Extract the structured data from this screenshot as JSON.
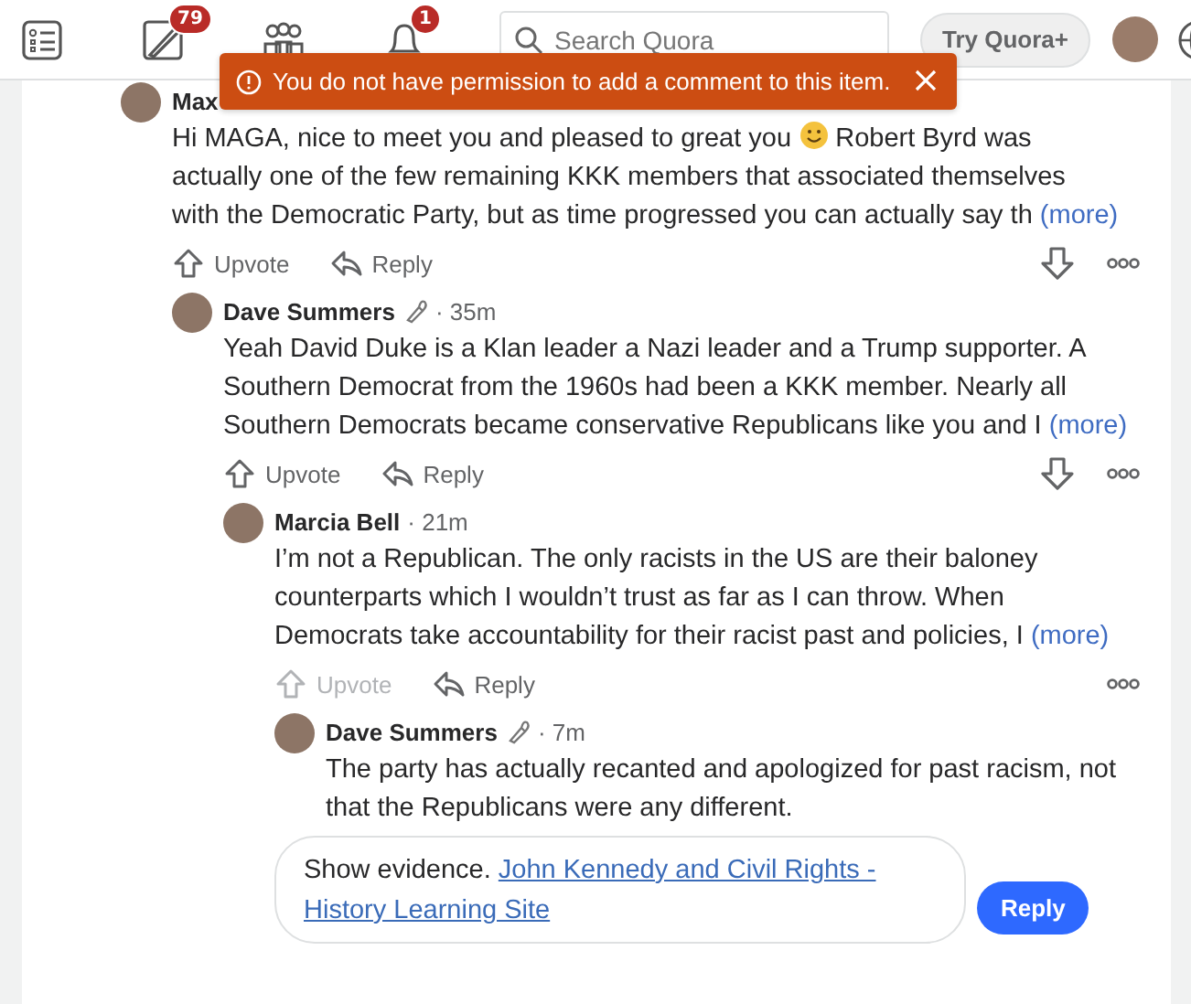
{
  "header": {
    "icons": [
      {
        "kind": "list"
      },
      {
        "kind": "pencil",
        "badge": "79"
      },
      {
        "kind": "people"
      },
      {
        "kind": "bell",
        "badge": "1"
      }
    ],
    "search": {
      "placeholder": "Search Quora"
    },
    "try_button": "Try Quora+"
  },
  "toast": {
    "message": "You do not have permission to add a comment to this item."
  },
  "comments": [
    {
      "author": "Max",
      "credential_icon": false,
      "lines": [
        [
          {
            "text": "Hi MAGA, nice to meet you and pleased to great you "
          },
          {
            "kind": "emoji"
          },
          {
            "text": " Robert Byrd was"
          }
        ],
        [
          {
            "text": "actually one of the few remaining KKK members that associated themselves"
          }
        ],
        [
          {
            "text": "with the Democratic Party, but as time progressed you can actually say th"
          }
        ]
      ],
      "more": "(more)",
      "actions": [
        {
          "kind": "upvote",
          "label": "Upvote",
          "disabled": false
        },
        {
          "kind": "reply",
          "label": "Reply",
          "disabled": false
        }
      ],
      "downvote": true,
      "children": [
        {
          "author": "Dave Summers",
          "credential_icon": true,
          "time": "· 35m",
          "lines": [
            [
              {
                "text": "Yeah David Duke is a Klan leader a Nazi leader and a Trump supporter. A"
              }
            ],
            [
              {
                "text": "Southern Democrat from the 1960s had been a KKK member. Nearly all"
              }
            ],
            [
              {
                "text": "Southern Democrats became conservative Republicans like you and I"
              }
            ]
          ],
          "more": "(more)",
          "actions": [
            {
              "kind": "upvote",
              "label": "Upvote",
              "disabled": false
            },
            {
              "kind": "reply",
              "label": "Reply",
              "disabled": false
            }
          ],
          "downvote": true,
          "children": [
            {
              "author": "Marcia Bell",
              "credential_icon": false,
              "time": "· 21m",
              "lines": [
                [
                  {
                    "text": "I’m not a Republican. The only racists in the US are their baloney"
                  }
                ],
                [
                  {
                    "text": "counterparts which I wouldn’t trust as far as I can throw. When"
                  }
                ],
                [
                  {
                    "text": "Democrats take accountability for their racist past and policies, I"
                  }
                ]
              ],
              "more": "(more)",
              "actions": [
                {
                  "kind": "upvote",
                  "label": "Upvote",
                  "disabled": true
                },
                {
                  "kind": "reply",
                  "label": "Reply",
                  "disabled": false
                }
              ],
              "downvote": false,
              "children": [
                {
                  "author": "Dave Summers",
                  "credential_icon": true,
                  "time": "· 7m",
                  "lines": [
                    [
                      {
                        "text": "The party has actually recanted and apologized for past racism, not"
                      }
                    ],
                    [
                      {
                        "text": "that the Republicans were any different."
                      }
                    ]
                  ]
                }
              ]
            }
          ]
        }
      ]
    }
  ],
  "reply_box": {
    "text": "Show evidence.",
    "link": "John Kennedy and Civil Rights - History Learning Site",
    "button": "Reply"
  }
}
